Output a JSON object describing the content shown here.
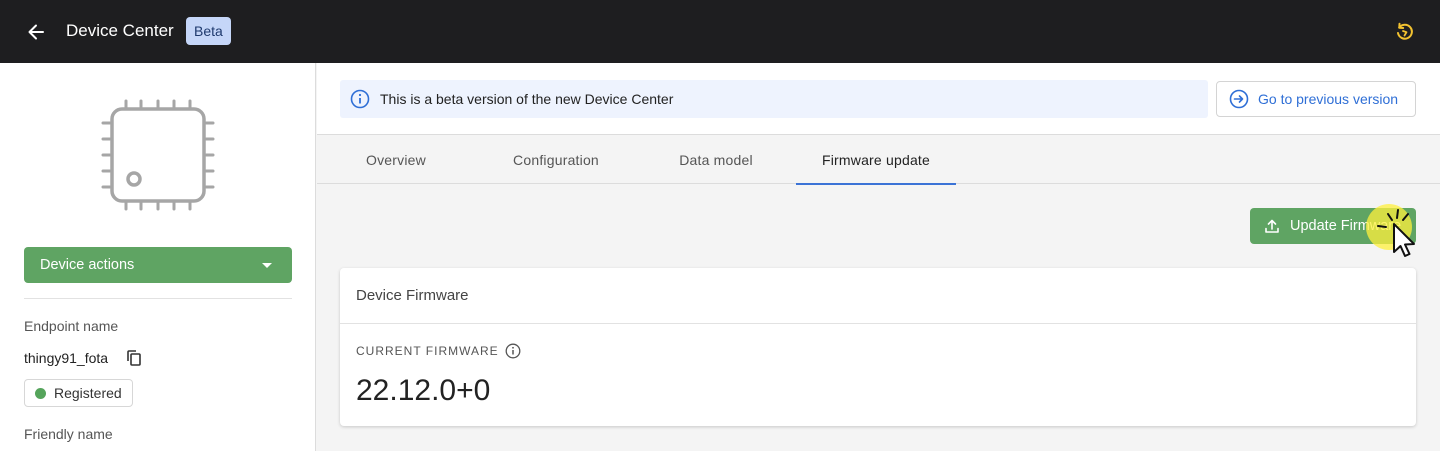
{
  "header": {
    "title": "Device Center",
    "badge": "Beta",
    "back_icon": "arrow-left-icon",
    "refresh_icon": "refresh-icon"
  },
  "sidebar": {
    "device_image_icon": "chip-icon",
    "device_actions_label": "Device actions",
    "endpoint_label": "Endpoint name",
    "endpoint_value": "thingy91_fota",
    "status": "Registered",
    "friendly_label": "Friendly name"
  },
  "notice": {
    "text": "This is a beta version of the new Device Center",
    "prev_button": "Go to previous version"
  },
  "tabs": [
    {
      "label": "Overview"
    },
    {
      "label": "Configuration"
    },
    {
      "label": "Data model"
    },
    {
      "label": "Firmware update"
    }
  ],
  "active_tab": "Firmware update",
  "firmware": {
    "update_button": "Update Firmware",
    "card_title": "Device Firmware",
    "current_label": "CURRENT FIRMWARE",
    "current_value": "22.12.0+0"
  },
  "colors": {
    "topbar": "#1e1e20",
    "accent_green": "#5fa463",
    "accent_blue": "#3b73d6",
    "refresh_yellow": "#f2c230",
    "status_green": "#55a45b"
  }
}
